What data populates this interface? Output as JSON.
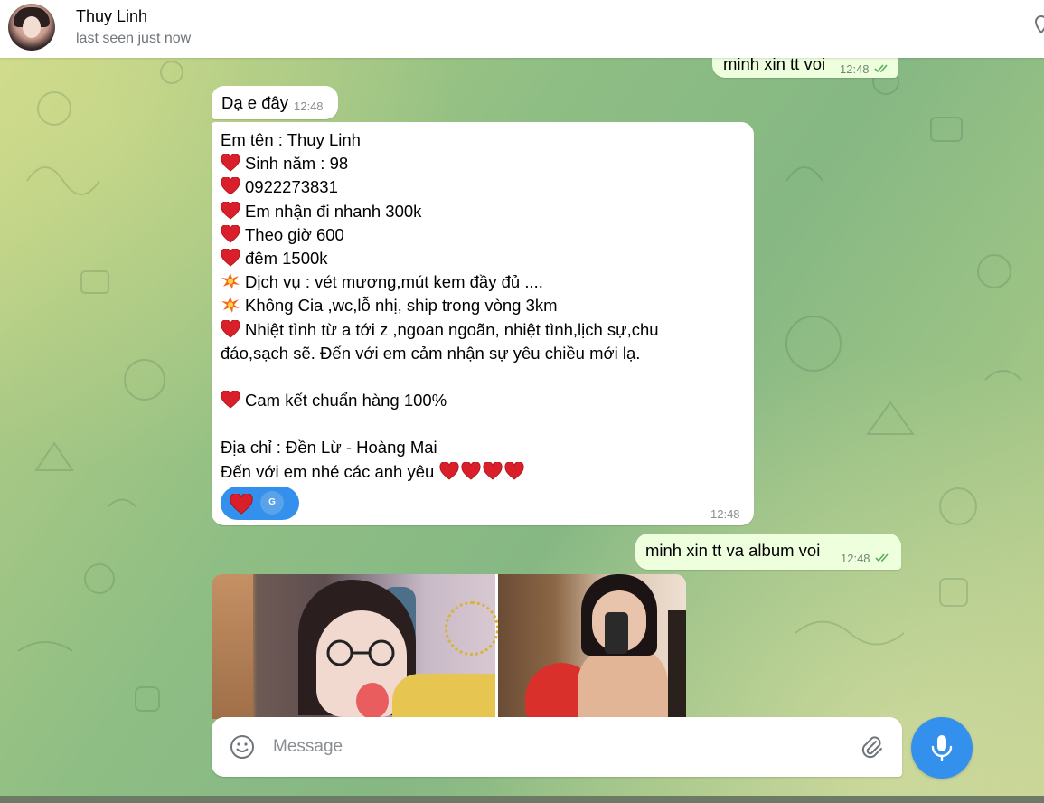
{
  "header": {
    "contact_name": "Thuy Linh",
    "status": "last seen just now"
  },
  "messages": {
    "top_out": {
      "text": "minh xin tt voi",
      "time": "12:48"
    },
    "intro": {
      "text": "Dạ e đây",
      "time": "12:48"
    },
    "main": {
      "lines": [
        {
          "icon": "",
          "text": "Em tên : Thuy Linh"
        },
        {
          "icon": "heart",
          "text": "Sinh năm : 98"
        },
        {
          "icon": "heart",
          "text": "0922273831"
        },
        {
          "icon": "heart",
          "text": "Em nhận đi nhanh 300k"
        },
        {
          "icon": "heart",
          "text": "Theo giờ 600"
        },
        {
          "icon": "heart",
          "text": "đêm 1500k"
        },
        {
          "icon": "boom",
          "text": "Dịch vụ : vét mương,mút kem đầy đủ ...."
        },
        {
          "icon": "boom",
          "text": "Không Cia ,wc,lỗ nhị, ship trong vòng 3km"
        },
        {
          "icon": "heart",
          "text": "Nhiệt tình từ a tới z ,ngoan ngoãn, nhiệt tình,lịch sự,chu"
        },
        {
          "icon": "",
          "text": "đáo,sạch sẽ. Đến với em cảm nhận sự yêu chiều mới lạ."
        },
        {
          "icon": "",
          "text": ""
        },
        {
          "icon": "heart",
          "text": "Cam kết chuẩn hàng 100%"
        },
        {
          "icon": "",
          "text": ""
        },
        {
          "icon": "",
          "text": "Địa chỉ : Đền Lừ - Hoàng Mai"
        },
        {
          "icon": "",
          "text": "Đến với em nhé các anh yêu"
        }
      ],
      "trailing_hearts": 4,
      "time": "12:48",
      "reaction": {
        "emoji": "heart",
        "avatar_letter": "G"
      }
    },
    "album_request": {
      "text": "minh xin tt va album voi",
      "time": "12:48"
    }
  },
  "composer": {
    "placeholder": "Message"
  },
  "colors": {
    "accent": "#3390ec",
    "outgoing_bubble": "#eeffde",
    "heart": "#d9202a"
  }
}
